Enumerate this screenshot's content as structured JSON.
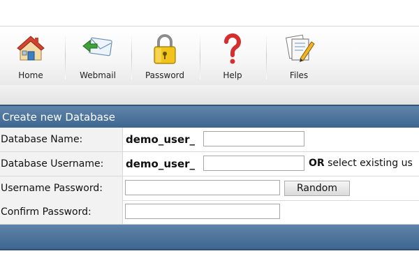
{
  "toolbar": {
    "items": [
      {
        "label": "Home",
        "icon": "home-icon"
      },
      {
        "label": "Webmail",
        "icon": "mail-icon"
      },
      {
        "label": "Password",
        "icon": "lock-icon"
      },
      {
        "label": "Help",
        "icon": "help-icon"
      },
      {
        "label": "Files",
        "icon": "files-icon"
      }
    ]
  },
  "panel": {
    "title": "Create new Database"
  },
  "form": {
    "db_name_label": "Database Name:",
    "db_name_prefix": "demo_user_",
    "db_name_value": "",
    "db_user_label": "Database Username:",
    "db_user_prefix": "demo_user_",
    "db_user_value": "",
    "or_label": "OR",
    "select_existing_text": " select existing us",
    "user_pass_label": "Username Password:",
    "user_pass_value": "",
    "random_button": "Random",
    "confirm_pass_label": "Confirm Password:",
    "confirm_pass_value": ""
  },
  "colors": {
    "header_blue": "#4f759c",
    "label_bg": "#f2f2f2"
  }
}
